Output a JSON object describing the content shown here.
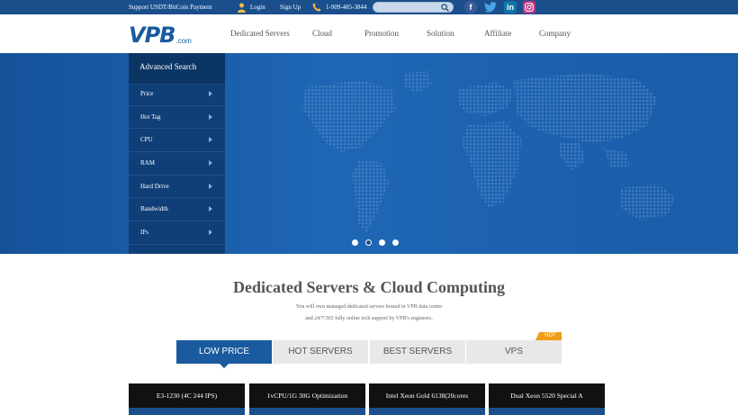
{
  "topbar": {
    "support": "Support USDT/BitCoin Payment",
    "login": "Login",
    "signup": "Sign Up",
    "phone": "1-909-485-3844",
    "search_placeholder": "",
    "social": [
      "facebook-icon",
      "twitter-icon",
      "linkedin-icon",
      "instagram-icon"
    ]
  },
  "header": {
    "logo_text": "VPB",
    "logo_suffix": ".com",
    "nav": [
      "Dedicated Servers",
      "Cloud",
      "Promotion",
      "Solution",
      "Affiliate",
      "Company"
    ]
  },
  "sidebar": {
    "title": "Advanced Search",
    "items": [
      "Price",
      "Hot Tag",
      "CPU",
      "RAM",
      "Hard Drive",
      "Bandwidth",
      "IPs"
    ]
  },
  "carousel": {
    "slides": 4,
    "active": 1
  },
  "main": {
    "title": "Dedicated Servers & Cloud Computing",
    "subtitle_line1": "You will own managed dedicated servers hosted in VPB data center",
    "subtitle_line2": "and 24/7/365 fully online tech support by VPB's engineers.",
    "tabs": [
      "LOW PRICE",
      "HOT SERVERS",
      "BEST SERVERS",
      "VPS"
    ],
    "active_tab": 0,
    "hot_badge": "HOT",
    "cards": [
      "E3-1230 (4C 244 IPS)",
      "1vCPU/1G  30G   Optimization",
      "Intel Xeon Gold 6138(20cores",
      "Dual Xeon 5520 Special A"
    ]
  },
  "colors": {
    "brand": "#1a5a9e",
    "topbar": "#1a4f8c",
    "hot": "#f39c12"
  }
}
